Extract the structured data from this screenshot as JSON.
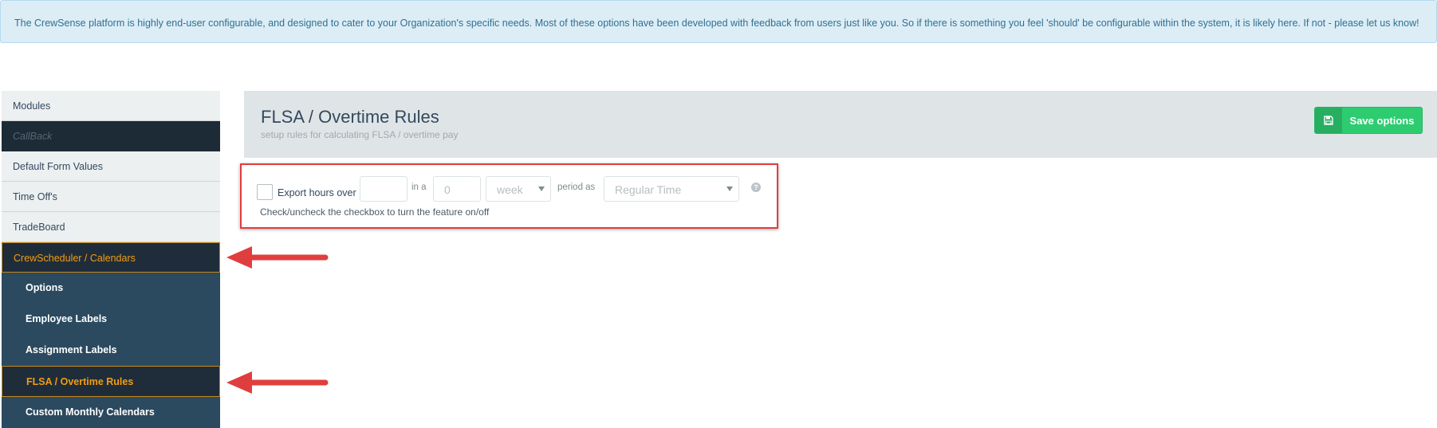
{
  "banner": {
    "text": "The CrewSense platform is highly end-user configurable, and designed to cater to your Organization's specific needs. Most of these options have been developed with feedback from users just like you. So if there is something you feel 'should' be configurable within the system, it is likely here. If not - please let us know!"
  },
  "sidebar": {
    "items": [
      {
        "label": "Modules"
      },
      {
        "label": "CallBack"
      },
      {
        "label": "Default Form Values"
      },
      {
        "label": "Time Off's"
      },
      {
        "label": "TradeBoard"
      },
      {
        "label": "CrewScheduler / Calendars"
      }
    ],
    "subitems": [
      {
        "label": "Options"
      },
      {
        "label": "Employee Labels"
      },
      {
        "label": "Assignment Labels"
      },
      {
        "label": "FLSA / Overtime Rules"
      },
      {
        "label": "Custom Monthly Calendars"
      }
    ]
  },
  "header": {
    "title": "FLSA / Overtime Rules",
    "subtitle": "setup rules for calculating FLSA / overtime pay"
  },
  "toolbar": {
    "save_label": "Save options",
    "save_icon": "floppy-disk-icon"
  },
  "rule": {
    "export_label": "Export hours over",
    "hours_value": "",
    "in_a_label": "in a",
    "period_count_placeholder": "0",
    "period_unit_selected": "week",
    "period_as_label": "period as",
    "time_type_selected": "Regular Time",
    "help_icon": "question-circle-icon",
    "hint": "Check/uncheck the checkbox to turn the feature on/off"
  },
  "colors": {
    "accent_orange": "#f39c12",
    "save_green": "#2ecc71",
    "annotation_red": "#e03e3e",
    "sidebar_dark": "#2b4a60"
  }
}
